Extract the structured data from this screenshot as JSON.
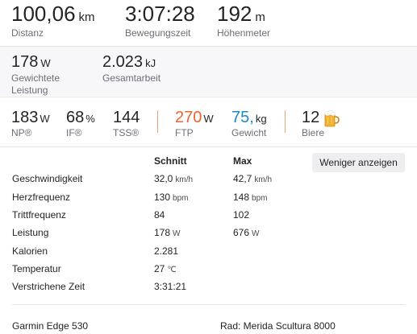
{
  "top": {
    "distance": {
      "value": "100,06",
      "unit": "km",
      "label": "Distanz"
    },
    "moving_time": {
      "value": "3:07:28",
      "label": "Bewegungszeit"
    },
    "elevation": {
      "value": "192",
      "unit": "m",
      "label": "Höhenmeter"
    }
  },
  "mid": {
    "weighted_power": {
      "value": "178",
      "unit": "W",
      "label_line1": "Gewichtete",
      "label_line2": "Leistung"
    },
    "total_work": {
      "value": "2.023",
      "unit": "kJ",
      "label": "Gesamtarbeit"
    }
  },
  "metrics": {
    "np": {
      "value": "183",
      "unit": "W",
      "label": "NP®"
    },
    "if": {
      "value": "68",
      "unit": "%",
      "label": "IF®"
    },
    "tss": {
      "value": "144",
      "label": "TSS®"
    },
    "ftp": {
      "value": "270",
      "unit": "W",
      "label": "FTP"
    },
    "weight": {
      "value": "75,",
      "unit": "kg",
      "label": "Gewicht"
    },
    "beers": {
      "value": "12",
      "label": "Biere",
      "icon": "beer-mug-icon"
    }
  },
  "colors": {
    "ftp": "#f0612c",
    "weight": "#1e88c7",
    "separator": "#f0a375"
  },
  "table": {
    "col_avg": "Schnitt",
    "col_max": "Max",
    "toggle_label": "Weniger anzeigen",
    "rows": [
      {
        "label": "Geschwindigkeit",
        "avg": "32,0",
        "avg_unit": "km/h",
        "max": "42,7",
        "max_unit": "km/h"
      },
      {
        "label": "Herzfrequenz",
        "avg": "130",
        "avg_unit": "bpm",
        "max": "148",
        "max_unit": "bpm"
      },
      {
        "label": "Trittfrequenz",
        "avg": "84",
        "avg_unit": "",
        "max": "102",
        "max_unit": ""
      },
      {
        "label": "Leistung",
        "avg": "178",
        "avg_unit": "W",
        "max": "676",
        "max_unit": "W"
      },
      {
        "label": "Kalorien",
        "avg": "2.281",
        "avg_unit": "",
        "max": "",
        "max_unit": ""
      },
      {
        "label": "Temperatur",
        "avg": "27",
        "avg_unit": "℃",
        "max": "",
        "max_unit": ""
      },
      {
        "label": "Verstrichene Zeit",
        "avg": "3:31:21",
        "avg_unit": "",
        "max": "",
        "max_unit": ""
      }
    ]
  },
  "footer": {
    "device": "Garmin Edge 530",
    "bike": "Rad: Merida Scultura 8000"
  }
}
